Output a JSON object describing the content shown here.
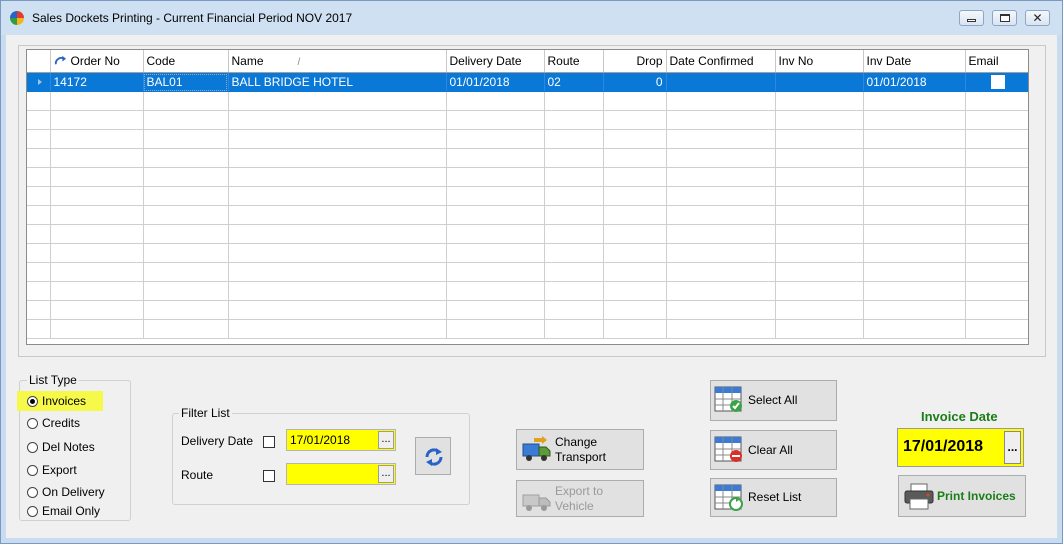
{
  "window": {
    "title": "Sales Dockets Printing - Current Financial Period NOV 2017",
    "controls": {
      "minimize_icon": "minimize-icon",
      "maximize_icon": "maximize-icon",
      "close_icon": "close-icon"
    }
  },
  "grid": {
    "columns": [
      "Order No",
      "Code",
      "Name",
      "Delivery Date",
      "Route",
      "Drop",
      "Date Confirmed",
      "Inv No",
      "Inv Date",
      "Email"
    ],
    "sort_indicator": "/",
    "rows": [
      {
        "order_no": "14172",
        "code": "BAL01",
        "name": "BALL BRIDGE HOTEL",
        "delivery_date": "01/01/2018",
        "route": "02",
        "drop": "0",
        "date_confirmed": "",
        "inv_no": "",
        "inv_date": "01/01/2018",
        "email": false
      }
    ],
    "selected_row_color": "#0a78d7"
  },
  "list_type": {
    "caption": "List Type",
    "options": [
      "Invoices",
      "Credits",
      "Del Notes",
      "Export",
      "On Delivery",
      "Email Only"
    ],
    "selected": "Invoices",
    "highlight_color": "#f7f94a"
  },
  "filter": {
    "caption": "Filter List",
    "delivery_date_label": "Delivery Date",
    "delivery_date_value": "17/01/2018",
    "route_label": "Route",
    "route_value": "",
    "ellipsis": "...",
    "field_color": "#ffff00"
  },
  "buttons": {
    "change_transport_line1": "Change",
    "change_transport_line2": "Transport",
    "export_line1": "Export to",
    "export_line2": "Vehicle",
    "select_all": "Select All",
    "clear_all": "Clear All",
    "reset_list": "Reset List",
    "print_invoices": "Print Invoices"
  },
  "invoice_date": {
    "title": "Invoice Date",
    "value": "17/01/2018",
    "ellipsis": "...",
    "title_color": "#1c7d17"
  }
}
